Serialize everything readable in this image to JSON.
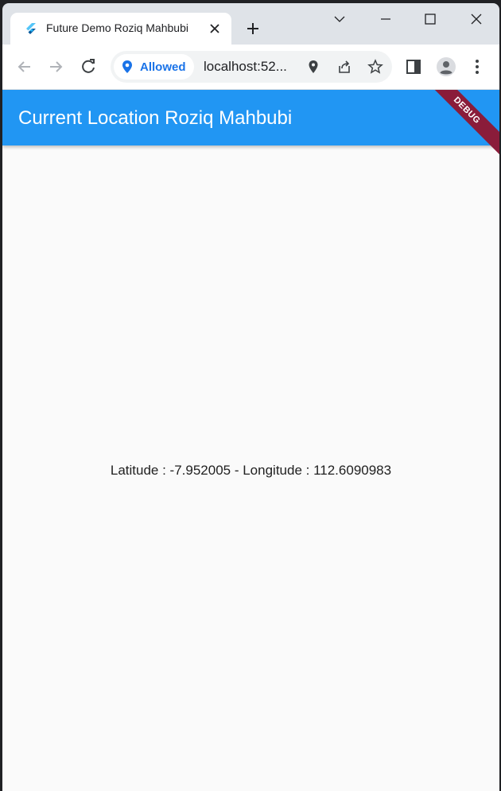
{
  "browser": {
    "tab_title": "Future Demo Roziq Mahbubi",
    "permission_chip": "Allowed",
    "url": "localhost:52..."
  },
  "app": {
    "title": "Current Location Roziq Mahbubi",
    "debug_banner": "DEBUG",
    "location_text": "Latitude : -7.952005 - Longitude : 112.6090983"
  },
  "colors": {
    "appbar": "#2196f3",
    "page_background": "#fafafa",
    "chip_text": "#1a73e8",
    "debug_banner": "#8a1c3a"
  },
  "icons": [
    "flutter-favicon-icon",
    "close-icon",
    "plus-icon",
    "chevron-down-icon",
    "minimize-icon",
    "maximize-icon",
    "close-window-icon",
    "back-icon",
    "forward-icon",
    "reload-icon",
    "location-pin-icon",
    "share-icon",
    "star-icon",
    "side-panel-icon",
    "profile-icon",
    "kebab-menu-icon"
  ]
}
